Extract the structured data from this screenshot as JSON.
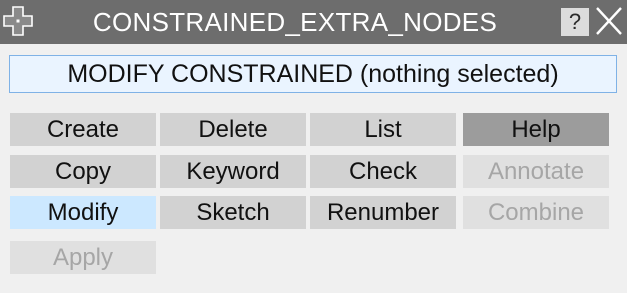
{
  "window": {
    "title": "CONSTRAINED_EXTRA_NODES",
    "help_button": "?",
    "close_icon": "close-x-icon",
    "move_icon": "move-cross-icon"
  },
  "status": {
    "text": "MODIFY CONSTRAINED (nothing selected)"
  },
  "buttons": {
    "create": "Create",
    "delete": "Delete",
    "list": "List",
    "help": "Help",
    "copy": "Copy",
    "keyword": "Keyword",
    "check": "Check",
    "annotate": "Annotate",
    "modify": "Modify",
    "sketch": "Sketch",
    "renumber": "Renumber",
    "combine": "Combine",
    "apply": "Apply"
  },
  "colors": {
    "titlebar": "#6d6d6d",
    "button": "#d2d2d2",
    "help_button": "#9c9c9c",
    "selected_button": "#cce8ff",
    "disabled_text": "#a6a6a6"
  }
}
